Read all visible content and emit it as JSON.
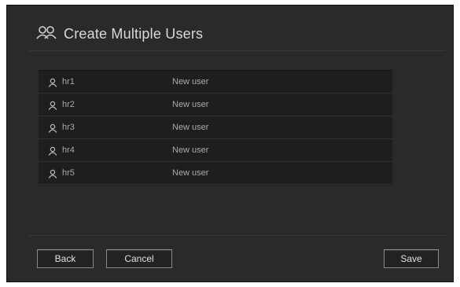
{
  "dialog": {
    "title": "Create Multiple Users",
    "title_icon": "users-icon"
  },
  "users": [
    {
      "name": "hr1",
      "status": "New user",
      "icon": "user-icon"
    },
    {
      "name": "hr2",
      "status": "New user",
      "icon": "user-icon"
    },
    {
      "name": "hr3",
      "status": "New user",
      "icon": "user-icon"
    },
    {
      "name": "hr4",
      "status": "New user",
      "icon": "user-icon"
    },
    {
      "name": "hr5",
      "status": "New user",
      "icon": "user-icon"
    }
  ],
  "buttons": {
    "back": "Back",
    "cancel": "Cancel",
    "save": "Save"
  },
  "colors": {
    "background": "#2a2a2a",
    "table_background": "#1e1e1e",
    "text": "#aaaaaa",
    "title": "#d9d9d9"
  }
}
